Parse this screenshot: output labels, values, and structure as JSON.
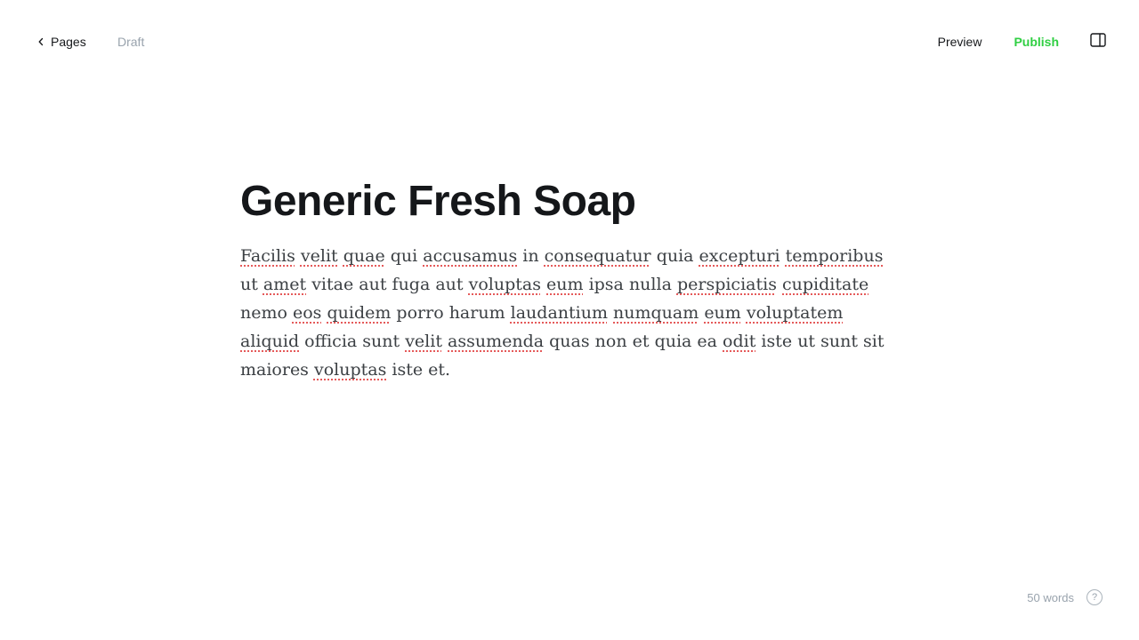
{
  "header": {
    "back_label": "Pages",
    "status": "Draft",
    "preview_label": "Preview",
    "publish_label": "Publish",
    "settings_icon": "sidebar-panel-icon",
    "back_icon": "chevron-left-icon"
  },
  "post": {
    "title": "Generic Fresh Soap",
    "body_words": [
      {
        "text": "Facilis",
        "misspelled": true
      },
      {
        "text": "velit",
        "misspelled": true
      },
      {
        "text": "quae",
        "misspelled": true
      },
      {
        "text": "qui",
        "misspelled": false
      },
      {
        "text": "accusamus",
        "misspelled": true
      },
      {
        "text": "in",
        "misspelled": false
      },
      {
        "text": "consequatur",
        "misspelled": true
      },
      {
        "text": "quia",
        "misspelled": false
      },
      {
        "text": "excepturi",
        "misspelled": true
      },
      {
        "text": "temporibus",
        "misspelled": true
      },
      {
        "text": "ut",
        "misspelled": false
      },
      {
        "text": "amet",
        "misspelled": true
      },
      {
        "text": "vitae",
        "misspelled": false
      },
      {
        "text": "aut",
        "misspelled": false
      },
      {
        "text": "fuga",
        "misspelled": false
      },
      {
        "text": "aut",
        "misspelled": false
      },
      {
        "text": "voluptas",
        "misspelled": true
      },
      {
        "text": "eum",
        "misspelled": true
      },
      {
        "text": "ipsa",
        "misspelled": false
      },
      {
        "text": "nulla",
        "misspelled": false
      },
      {
        "text": "perspiciatis",
        "misspelled": true
      },
      {
        "text": "cupiditate",
        "misspelled": true
      },
      {
        "text": "nemo",
        "misspelled": false
      },
      {
        "text": "eos",
        "misspelled": true
      },
      {
        "text": "quidem",
        "misspelled": true
      },
      {
        "text": "porro",
        "misspelled": false
      },
      {
        "text": "harum",
        "misspelled": false
      },
      {
        "text": "laudantium",
        "misspelled": true
      },
      {
        "text": "numquam",
        "misspelled": true
      },
      {
        "text": "eum",
        "misspelled": true
      },
      {
        "text": "voluptatem",
        "misspelled": true
      },
      {
        "text": "aliquid",
        "misspelled": true
      },
      {
        "text": "officia",
        "misspelled": false
      },
      {
        "text": "sunt",
        "misspelled": false
      },
      {
        "text": "velit",
        "misspelled": true
      },
      {
        "text": "assumenda",
        "misspelled": true
      },
      {
        "text": "quas",
        "misspelled": false
      },
      {
        "text": "non",
        "misspelled": false
      },
      {
        "text": "et",
        "misspelled": false
      },
      {
        "text": "quia",
        "misspelled": false
      },
      {
        "text": "ea",
        "misspelled": false
      },
      {
        "text": "odit",
        "misspelled": true
      },
      {
        "text": "iste",
        "misspelled": false
      },
      {
        "text": "ut",
        "misspelled": false
      },
      {
        "text": "sunt",
        "misspelled": false
      },
      {
        "text": "sit",
        "misspelled": false
      },
      {
        "text": "maiores",
        "misspelled": false
      },
      {
        "text": "voluptas",
        "misspelled": true
      },
      {
        "text": "iste",
        "misspelled": false
      },
      {
        "text": "et.",
        "misspelled": false
      }
    ]
  },
  "footer": {
    "word_count": "50 words",
    "help_label": "?",
    "help_icon": "help-circle-icon"
  },
  "colors": {
    "publish": "#30cf43",
    "muted": "#99a3ad",
    "text": "#15171a",
    "spellcheck": "#e55a5a"
  }
}
